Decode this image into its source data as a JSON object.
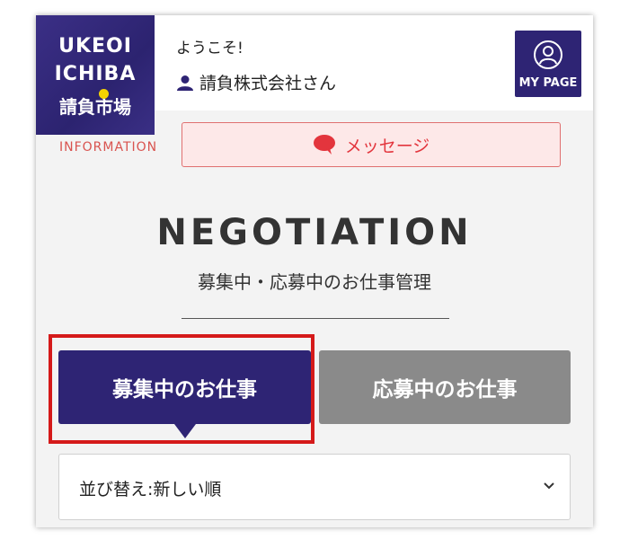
{
  "logo": {
    "line1": "UKEOI",
    "line2": "ICHIBA",
    "line3": "請負市場"
  },
  "information_label": "INFORMATION",
  "header": {
    "welcome": "ようこそ!",
    "company": "請負株式会社さん",
    "mypage_label": "MY PAGE"
  },
  "message_button": {
    "label": "メッセージ",
    "icon": "speech-bubble-icon"
  },
  "page": {
    "title": "NEGOTIATION",
    "subtitle": "募集中・応募中のお仕事管理"
  },
  "tabs": [
    {
      "label": "募集中のお仕事",
      "active": true
    },
    {
      "label": "応募中のお仕事",
      "active": false
    }
  ],
  "sort": {
    "selected": "並び替え:新しい順"
  },
  "colors": {
    "brand": "#2e2474",
    "accent_red": "#e3353d",
    "inactive_tab": "#8a8a8a",
    "highlight": "#d51a1a",
    "logo_dot": "#f5d200"
  }
}
